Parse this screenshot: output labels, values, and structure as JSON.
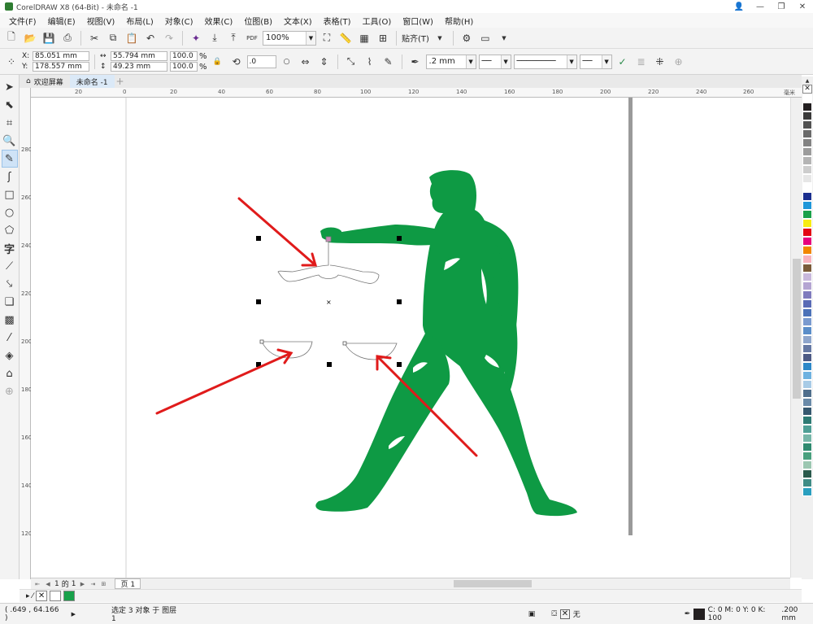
{
  "window": {
    "title": "CorelDRAW X8 (64-Bit) - 未命名 -1",
    "controls": [
      "minimize-icon",
      "restore-icon",
      "close-icon"
    ]
  },
  "menu": [
    "文件(F)",
    "编辑(E)",
    "视图(V)",
    "布局(L)",
    "对象(C)",
    "效果(C)",
    "位图(B)",
    "文本(X)",
    "表格(T)",
    "工具(O)",
    "窗口(W)",
    "帮助(H)"
  ],
  "toolbar1": {
    "zoom": "100%",
    "snap_label": "贴齐(T)"
  },
  "property_bar": {
    "x": "85.051 mm",
    "y": "178.557 mm",
    "width": "55.794 mm",
    "height": "49.23 mm",
    "scale_x": "100.0",
    "scale_y": "100.0",
    "percent": "%",
    "rotation": ".0",
    "outline_width": ".2 mm",
    "x_label": "X:",
    "y_label": "Y:"
  },
  "tabs": [
    {
      "label": "欢迎屏幕",
      "active": false
    },
    {
      "label": "未命名 -1",
      "active": true
    }
  ],
  "hruler": {
    "labels": [
      "20",
      "0",
      "20",
      "40",
      "60",
      "80",
      "100",
      "120",
      "140",
      "160",
      "180",
      "200",
      "220",
      "240",
      "260"
    ],
    "unit": "毫米"
  },
  "vruler": {
    "labels": [
      "280",
      "260",
      "240",
      "220",
      "200",
      "180",
      "160",
      "140",
      "120",
      "100",
      "80"
    ]
  },
  "page_nav": {
    "current": "1",
    "of_label": "的",
    "total": "1",
    "page_tab": "页 1"
  },
  "status": {
    "coords": "( .649 , 64.166 )",
    "selection": "选定 3 对象 于 图层 1",
    "fill_none": "无",
    "outline_color": "C: 0 M: 0 Y: 0 K: 100",
    "outline_width": ".200 mm"
  },
  "colors": {
    "figure_green": "#0e9a44",
    "arrow_red": "#e01b1b",
    "doc_green": "#18a14a"
  },
  "palette": [
    "#ffffff",
    "#231f20",
    "#3a3a3a",
    "#525252",
    "#6b6b6b",
    "#838383",
    "#9c9c9c",
    "#b4b4b4",
    "#cdcdcd",
    "#e6e6e6",
    "#ffffff",
    "#1b2f8f",
    "#1f97d9",
    "#1aa14a",
    "#f7ec13",
    "#e30613",
    "#e6007e",
    "#f18700",
    "#f7b3bf",
    "#7b5c3a",
    "#c8b8dc",
    "#b4a5d2",
    "#7f7bbd",
    "#5a6bb5",
    "#4c72b8",
    "#7a9acf",
    "#5b8ec9",
    "#8fa6cc",
    "#6679a3",
    "#4d5b85",
    "#2d88c8",
    "#6fb2e0",
    "#a8cbe6",
    "#4f6e8c",
    "#6a8aa8",
    "#36586f",
    "#2d7a73",
    "#4e9f95",
    "#76b6a8",
    "#2f8a6f",
    "#49a07e",
    "#9cc7b1",
    "#2a5a4c",
    "#3f8c85",
    "#2a9fbf"
  ]
}
